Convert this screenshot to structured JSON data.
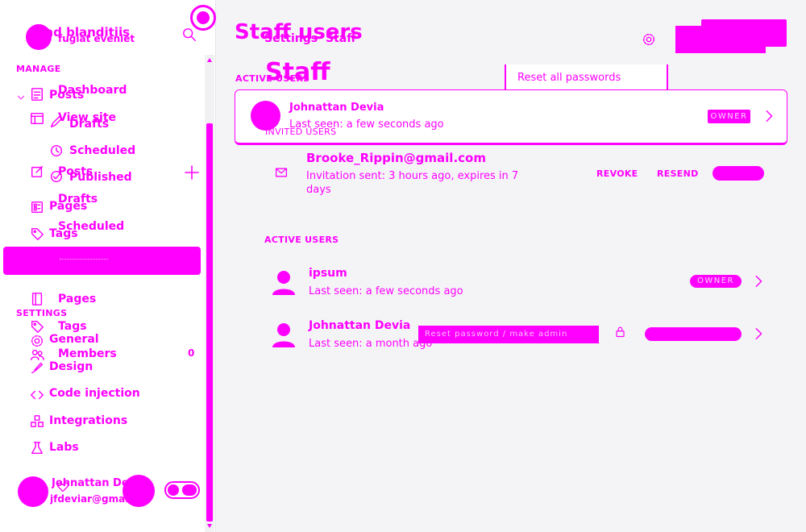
{
  "colors": {
    "accent": "#ff00ff",
    "sidebar_bg": "#ffffff",
    "main_bg": "#f4f4f7"
  },
  "sidebar": {
    "site_title": "ad blanditiis",
    "site_subtitle": "fugiat eveniet",
    "manage_heading": "MANAGE",
    "settings_heading": "SETTINGS",
    "items": {
      "dashboard": "Dashboard",
      "view_site": "View site",
      "posts_a": "Posts",
      "drafts_a": "Drafts",
      "scheduled_a": "Scheduled",
      "posts_b": "Posts",
      "published": "Published",
      "drafts_b": "Drafts",
      "pages_a": "Pages",
      "scheduled_b": "Scheduled",
      "tags_a": "Tags",
      "pages_b": "Pages",
      "tags_b": "Tags",
      "general": "General",
      "members": "Members",
      "members_count": "0",
      "design": "Design",
      "code_injection": "Code injection",
      "integrations": "Integrations",
      "labs": "Labs"
    },
    "user": {
      "name": "Johnattan Devia",
      "email": "jfdeviar@gmail.com"
    }
  },
  "main": {
    "page_title": "Staff users",
    "breadcrumb": {
      "parent": "Settings",
      "separator": "›",
      "current": "Staff"
    },
    "header_title": "Staff",
    "dropdown_item": "Reset all passwords",
    "top_card": {
      "section_label": "ACTIVE USERS",
      "name": "Johnattan Devia",
      "last_seen": "Last seen: a few seconds ago",
      "overlay_label": "INVITED USERS",
      "badge": "OWNER"
    },
    "invited": {
      "email": "Brooke_Rippin@gmail.com",
      "status_line1": "Invitation sent: 3 hours ago, expires in 7",
      "status_line2": "days",
      "revoke": "REVOKE",
      "resend": "RESEND"
    },
    "active_label": "ACTIVE USERS",
    "active_users": [
      {
        "name": "ipsum",
        "last_seen": "Last seen: a few seconds ago",
        "badge": "OWNER"
      },
      {
        "name": "Johnattan Devia",
        "last_seen": "Last seen: a month ago",
        "tooltip": "Reset password / make admin"
      }
    ]
  }
}
